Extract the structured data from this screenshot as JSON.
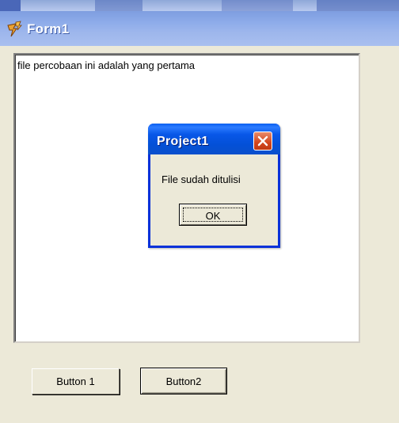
{
  "form": {
    "title": "Form1"
  },
  "memo": {
    "text": "file percobaan ini adalah yang pertama"
  },
  "dialog": {
    "title": "Project1",
    "message": "File sudah ditulisi",
    "ok_label": "OK"
  },
  "buttons": {
    "button1_label": "Button 1",
    "button2_label": "Button2"
  },
  "colors": {
    "window_bg": "#ECE9D8",
    "dialog_titlebar": "#0450D6",
    "form_titlebar": "#8FADEA",
    "close_button": "#D2451C"
  },
  "icons": {
    "form_icon": "delphi-form-icon",
    "dialog_close": "close-icon"
  }
}
